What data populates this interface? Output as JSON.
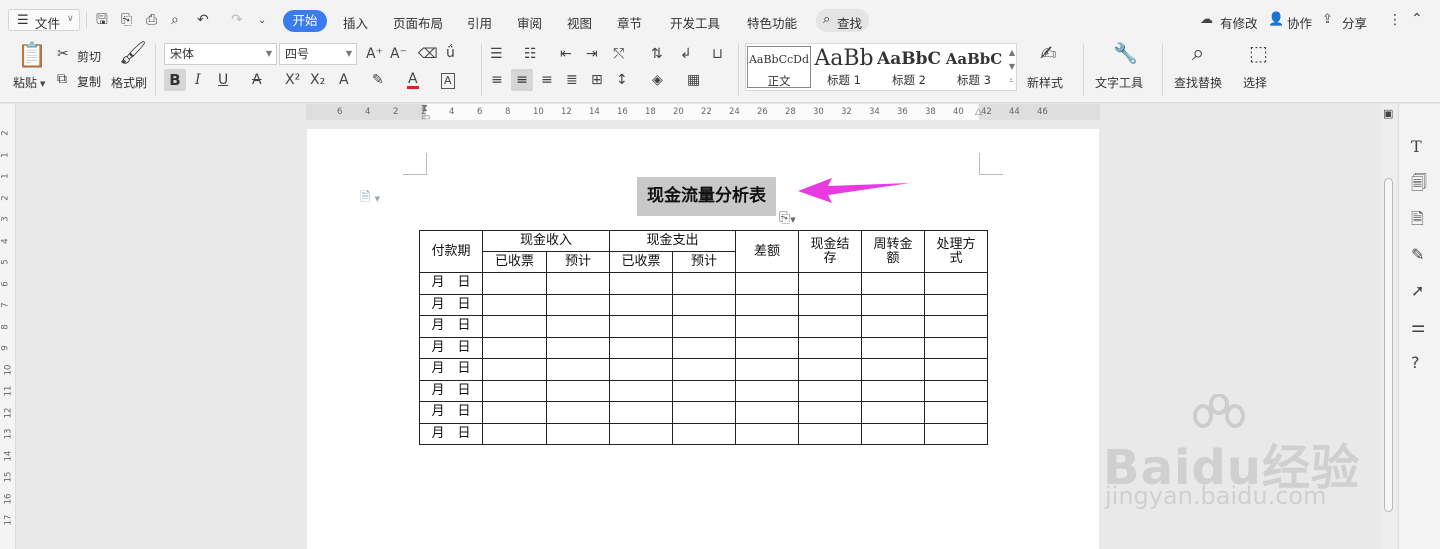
{
  "menubar": {
    "file": "文件",
    "tabs": [
      "开始",
      "插入",
      "页面布局",
      "引用",
      "审阅",
      "视图",
      "章节",
      "开发工具",
      "特色功能"
    ],
    "active_tab": "开始",
    "search": "查找",
    "has_changes": "有修改",
    "collab": "协作",
    "share": "分享"
  },
  "ribbon": {
    "paste": "粘贴",
    "cut": "剪切",
    "copy": "复制",
    "format_painter": "格式刷",
    "font_name": "宋体",
    "font_size": "四号",
    "styles": [
      {
        "preview": "AaBbCcDd",
        "name": "正文"
      },
      {
        "preview": "AaBb",
        "name": "标题 1"
      },
      {
        "preview": "AaBbC",
        "name": "标题 2"
      },
      {
        "preview": "AaBbC",
        "name": "标题 3"
      }
    ],
    "new_style": "新样式",
    "text_tools": "文字工具",
    "find_replace": "查找替换",
    "select": "选择"
  },
  "ruler": {
    "h_ticks": [
      "6",
      "4",
      "2",
      "2",
      "4",
      "6",
      "8",
      "10",
      "12",
      "14",
      "16",
      "18",
      "20",
      "22",
      "24",
      "26",
      "28",
      "30",
      "32",
      "34",
      "36",
      "38",
      "40",
      "42",
      "44",
      "46"
    ],
    "v_ticks": [
      "2",
      "1",
      "1",
      "2",
      "3",
      "4",
      "5",
      "6",
      "7",
      "8",
      "9",
      "10",
      "11",
      "12",
      "13",
      "14",
      "15",
      "16",
      "17"
    ]
  },
  "document": {
    "title": "现金流量分析表",
    "table": {
      "col_payment": "付款期",
      "group_income": "现金收入",
      "group_expense": "现金支出",
      "received": "已收票",
      "estimate": "预计",
      "difference": "差额",
      "cash_balance": "现金结存",
      "turnover": "周转金额",
      "processing": "处理方式",
      "row_label": "月　日",
      "row_count": 8
    }
  },
  "watermark": {
    "brand": "Baidu经验",
    "url": "jingyan.baidu.com"
  },
  "colors": {
    "accent": "#3a7bf0",
    "arrow": "#e83ae0"
  }
}
